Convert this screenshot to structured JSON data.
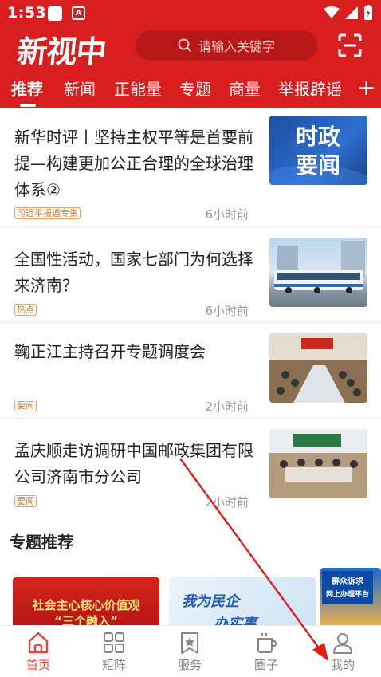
{
  "status_bar": {
    "time": "1:53"
  },
  "header": {
    "logo": "新视中",
    "search_placeholder": "请输入关键字"
  },
  "tabs": [
    {
      "label": "推荐",
      "active": true
    },
    {
      "label": "新闻"
    },
    {
      "label": "正能量"
    },
    {
      "label": "专题"
    },
    {
      "label": "商量"
    },
    {
      "label": "举报辟谣"
    }
  ],
  "news": [
    {
      "title": "新华时评丨坚持主权平等是首要前提—构建更加公正合理的全球治理体系②",
      "tag": "习近平报道专集",
      "time": "6小时前",
      "thumb_text": [
        "时政",
        "要闻"
      ]
    },
    {
      "title": "全国性活动，国家七部门为何选择来济南？",
      "tag": "热点",
      "time": "6小时前"
    },
    {
      "title": "鞠正江主持召开专题调度会",
      "tag": "要闻",
      "time": "2小时前"
    },
    {
      "title": "孟庆顺走访调研中国邮政集团有限公司济南市分公司",
      "tag": "要闻",
      "time": "2小时前"
    }
  ],
  "section": {
    "title": "专题推荐"
  },
  "cards": [
    {
      "line1": "社会主心核心价值观",
      "line2": "“三个融入”"
    },
    {
      "line1": "我为民企",
      "line2": "办实事"
    },
    {
      "line1": "群众诉求",
      "line2": "网上办理平台"
    }
  ],
  "bottom_nav": [
    {
      "label": "首页",
      "active": true,
      "icon": "home-icon"
    },
    {
      "label": "矩阵",
      "icon": "grid-icon"
    },
    {
      "label": "服务",
      "icon": "star-bookmark-icon"
    },
    {
      "label": "圈子",
      "icon": "cup-icon"
    },
    {
      "label": "我的",
      "icon": "user-icon"
    }
  ],
  "colors": {
    "brand_red": "#d81e1e",
    "active_nav": "#e2453a",
    "tag_orange": "#e07a2c"
  }
}
